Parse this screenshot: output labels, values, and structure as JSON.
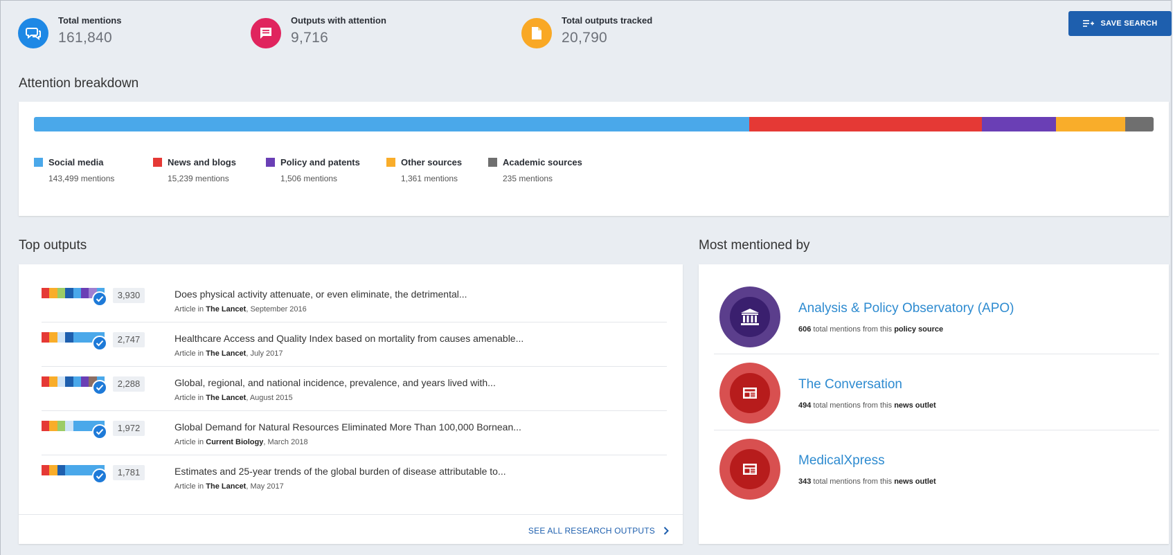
{
  "summary": {
    "total_mentions": {
      "label": "Total mentions",
      "value": "161,840",
      "icon": "chat-bubbles-icon",
      "color": "#1e88e5"
    },
    "outputs_with_attention": {
      "label": "Outputs with attention",
      "value": "9,716",
      "icon": "comment-icon",
      "color": "#e0245e"
    },
    "total_outputs_tracked": {
      "label": "Total outputs tracked",
      "value": "20,790",
      "icon": "document-icon",
      "color": "#f9a825"
    }
  },
  "save_search": {
    "label": "SAVE SEARCH",
    "icon": "playlist-add-icon"
  },
  "attention_breakdown": {
    "title": "Attention breakdown",
    "segments": [
      {
        "name": "Social media",
        "mentions": "143,499 mentions",
        "color": "#4aa8ea",
        "fraction": 0.6389
      },
      {
        "name": "News and blogs",
        "mentions": "15,239 mentions",
        "color": "#e53935",
        "fraction": 0.2076
      },
      {
        "name": "Policy and patents",
        "mentions": "1,506 mentions",
        "color": "#6a3fb5",
        "fraction": 0.0664
      },
      {
        "name": "Other sources",
        "mentions": "1,361 mentions",
        "color": "#f9ad2a",
        "fraction": 0.0616
      },
      {
        "name": "Academic sources",
        "mentions": "235 mentions",
        "color": "#6f6f6f",
        "fraction": 0.0255
      }
    ]
  },
  "top_outputs": {
    "title": "Top outputs",
    "items": [
      {
        "score": "3,930",
        "title": "Does physical activity attenuate, or even eliminate, the detrimental...",
        "prefix": "Article in ",
        "journal": "The Lancet",
        "date": ", September 2016"
      },
      {
        "score": "2,747",
        "title": "Healthcare Access and Quality Index based on mortality from causes amenable...",
        "prefix": "Article in ",
        "journal": "The Lancet",
        "date": ", July 2017"
      },
      {
        "score": "2,288",
        "title": "Global, regional, and national incidence, prevalence, and years lived with...",
        "prefix": "Article in ",
        "journal": "The Lancet",
        "date": ", August 2015"
      },
      {
        "score": "1,972",
        "title": "Global Demand for Natural Resources Eliminated More Than 100,000 Bornean...",
        "prefix": "Article in ",
        "journal": "Current Biology",
        "date": ", March 2018"
      },
      {
        "score": "1,781",
        "title": "Estimates and 25-year trends of the global burden of disease attributable to...",
        "prefix": "Article in ",
        "journal": "The Lancet",
        "date": ", May 2017"
      }
    ],
    "see_all": "SEE ALL RESEARCH OUTPUTS"
  },
  "most_mentioned": {
    "title": "Most mentioned by",
    "items": [
      {
        "name": "Analysis & Policy Observatory (APO)",
        "count": "606",
        "mid": " total mentions from this ",
        "type": "policy source",
        "icon": "institution-icon",
        "outer": "#5b3e8c",
        "inner": "#3a1f6e"
      },
      {
        "name": "The Conversation",
        "count": "494",
        "mid": " total mentions from this ",
        "type": "news outlet",
        "icon": "newspaper-icon",
        "outer": "#d85050",
        "inner": "#b71c1c"
      },
      {
        "name": "MedicalXpress",
        "count": "343",
        "mid": " total mentions from this ",
        "type": "news outlet",
        "icon": "newspaper-icon",
        "outer": "#d85050",
        "inner": "#b71c1c"
      }
    ]
  }
}
